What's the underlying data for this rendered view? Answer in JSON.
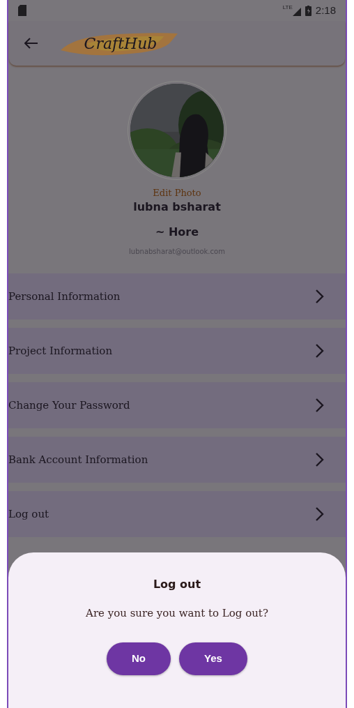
{
  "status_bar": {
    "network": "LTE",
    "time": "2:18"
  },
  "app_bar": {
    "logo": "CraftHub"
  },
  "profile": {
    "edit_photo": "Edit Photo",
    "name": "lubna bsharat",
    "role": "~ Hore",
    "email": "lubnabsharat@outlook.com"
  },
  "menu": [
    {
      "label": "Personal Information"
    },
    {
      "label": "Project Information"
    },
    {
      "label": "Change Your Password"
    },
    {
      "label": "Bank Account Information"
    },
    {
      "label": "Log out"
    }
  ],
  "dialog": {
    "title": "Log out",
    "message": "Are you sure you want to Log out?",
    "buttons": [
      "No",
      "Yes"
    ]
  }
}
